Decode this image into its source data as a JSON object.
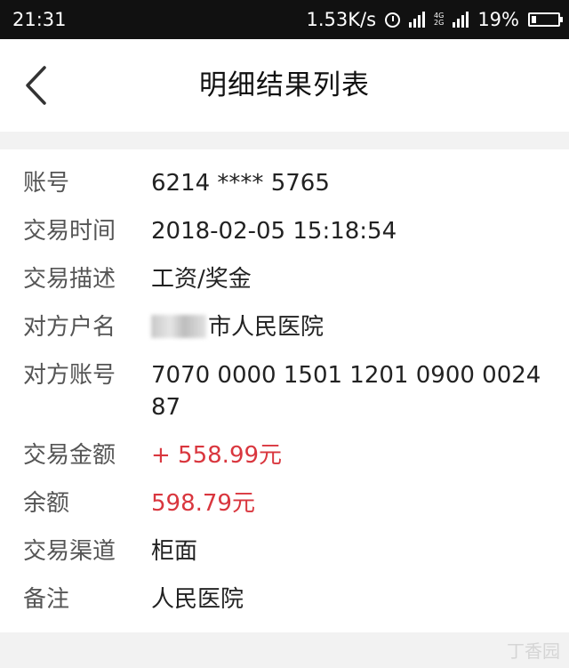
{
  "status_bar": {
    "time": "21:31",
    "speed": "1.53K/s",
    "alarm_icon": "alarm-icon",
    "network_badge_top": "4G",
    "network_badge_bottom": "2G",
    "battery": "19%",
    "battery_level": 0.19
  },
  "nav": {
    "back_icon": "chevron-left-icon",
    "title": "明细结果列表"
  },
  "details": {
    "account": {
      "label": "账号",
      "value": "6214 **** 5765"
    },
    "time": {
      "label": "交易时间",
      "value": "2018-02-05 15:18:54"
    },
    "description": {
      "label": "交易描述",
      "value": "工资/奖金"
    },
    "counterparty_name": {
      "label": "对方户名",
      "value": "市人民医院"
    },
    "counterparty_account": {
      "label": "对方账号",
      "value": "7070 0000 1501 1201 0900 0024 87"
    },
    "amount": {
      "label": "交易金额",
      "value": "+ 558.99元"
    },
    "balance": {
      "label": "余额",
      "value": "598.79元"
    },
    "channel": {
      "label": "交易渠道",
      "value": "柜面"
    },
    "remark": {
      "label": "备注",
      "value": "人民医院"
    }
  },
  "colors": {
    "amount_red": "#d9363e",
    "status_bar_bg": "#111111",
    "page_bg": "#f2f2f2"
  },
  "watermark": "丁香园"
}
